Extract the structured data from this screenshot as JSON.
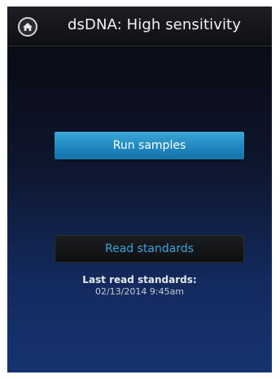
{
  "header": {
    "home_icon": "home-icon",
    "title": "dsDNA: High sensitivity"
  },
  "actions": {
    "run_samples_label": "Run samples",
    "read_standards_label": "Read standards"
  },
  "status": {
    "last_read_label": "Last read standards:",
    "last_read_value": "02/13/2014 9:45am"
  },
  "colors": {
    "primary_button": "#1f88bf",
    "secondary_button_text": "#3da2dd",
    "background_bottom": "#163370"
  }
}
